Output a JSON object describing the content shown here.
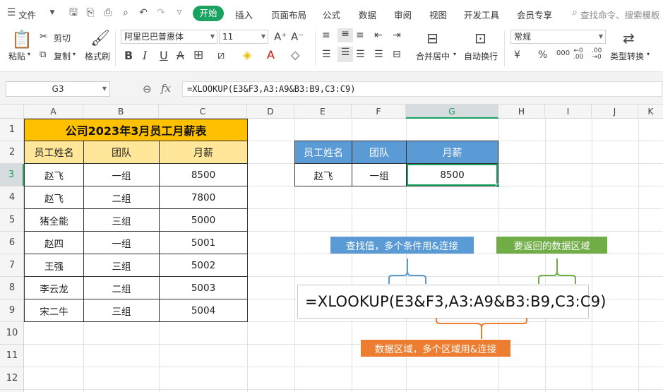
{
  "menubar": {
    "file": "文件",
    "tabs": [
      "开始",
      "插入",
      "页面布局",
      "公式",
      "数据",
      "审阅",
      "视图",
      "开发工具",
      "会员专享"
    ],
    "active_tab": "开始",
    "search_placeholder": "查找命令、搜索模板"
  },
  "ribbon": {
    "paste": "粘贴",
    "cut": "剪切",
    "copy": "复制",
    "format_painter": "格式刷",
    "font_name": "阿里巴巴普惠体",
    "font_size": "11",
    "merge_center": "合并居中",
    "wrap_text": "自动换行",
    "number_format": "常规",
    "type_convert": "类型转换",
    "increase_font": "A⁺",
    "decrease_font": "A⁻"
  },
  "formula_bar": {
    "cell_ref": "G3",
    "fx": "fx",
    "formula": "=XLOOKUP(E3&F3,A3:A9&B3:B9,C3:C9)"
  },
  "columns": [
    "A",
    "B",
    "C",
    "D",
    "E",
    "F",
    "G",
    "H",
    "I",
    "J",
    "K"
  ],
  "selected_column": "G",
  "rows": [
    "1",
    "2",
    "3",
    "4",
    "5",
    "6",
    "7",
    "8",
    "9",
    "10",
    "11",
    "12"
  ],
  "selected_row": "3",
  "main_table": {
    "title": "公司2023年3月员工月薪表",
    "headers": [
      "员工姓名",
      "团队",
      "月薪"
    ],
    "rows": [
      [
        "赵飞",
        "一组",
        "8500"
      ],
      [
        "赵飞",
        "二组",
        "7800"
      ],
      [
        "猪全能",
        "三组",
        "5000"
      ],
      [
        "赵四",
        "一组",
        "5001"
      ],
      [
        "王强",
        "三组",
        "5002"
      ],
      [
        "李云龙",
        "二组",
        "5003"
      ],
      [
        "宋二牛",
        "三组",
        "5004"
      ]
    ]
  },
  "lookup_table": {
    "headers": [
      "员工姓名",
      "团队",
      "月薪"
    ],
    "row": [
      "赵飞",
      "一组",
      "8500"
    ]
  },
  "annotations": {
    "lookup_value": "查找值，多个条件用&连接",
    "return_range": "要返回的数据区域",
    "lookup_range": "数据区域，多个区域用&连接",
    "formula": "=XLOOKUP(E3&F3,A3:A9&B3:B9,C3:C9)"
  },
  "colors": {
    "accent": "#1aa260",
    "title_fill": "#ffc000",
    "header_fill": "#ffe699",
    "lookup_header_fill": "#5b9bd5",
    "anno_blue": "#5b9bd5",
    "anno_green": "#70ad47",
    "anno_orange": "#ed7d31"
  }
}
